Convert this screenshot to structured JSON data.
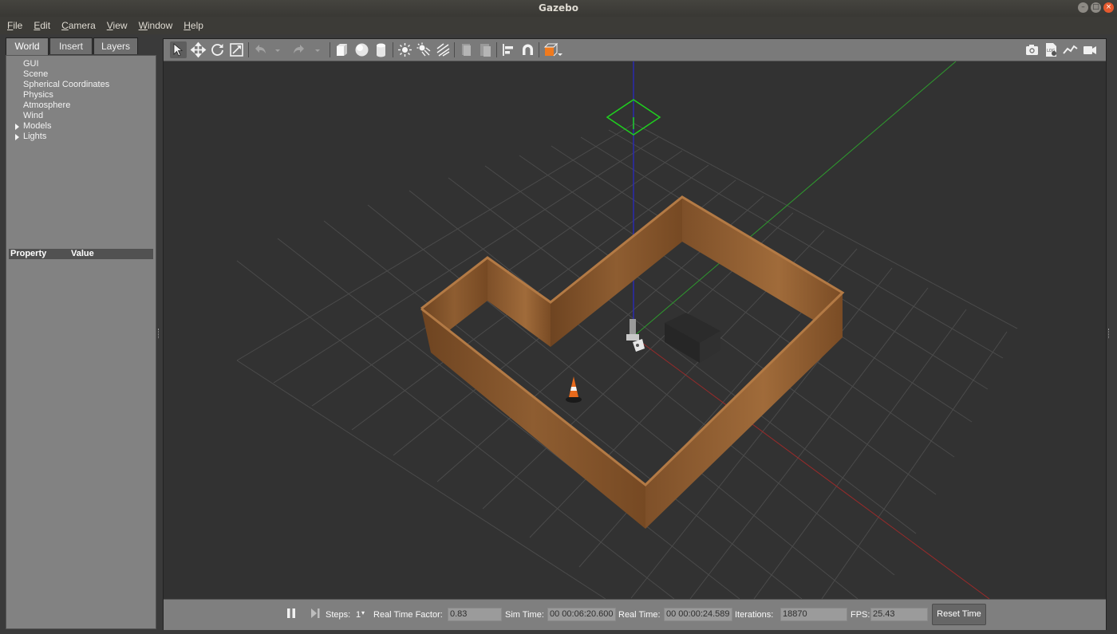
{
  "window": {
    "title": "Gazebo"
  },
  "menubar": [
    "File",
    "Edit",
    "Camera",
    "View",
    "Window",
    "Help"
  ],
  "left_panel": {
    "tabs": [
      "World",
      "Insert",
      "Layers"
    ],
    "active_tab": "World",
    "tree": [
      {
        "label": "GUI",
        "expandable": false
      },
      {
        "label": "Scene",
        "expandable": false
      },
      {
        "label": "Spherical Coordinates",
        "expandable": false
      },
      {
        "label": "Physics",
        "expandable": false
      },
      {
        "label": "Atmosphere",
        "expandable": false
      },
      {
        "label": "Wind",
        "expandable": false
      },
      {
        "label": "Models",
        "expandable": true
      },
      {
        "label": "Lights",
        "expandable": true
      }
    ],
    "property_header": {
      "property": "Property",
      "value": "Value"
    }
  },
  "toolbar": {
    "tools": [
      "select-mode",
      "translate-mode",
      "rotate-mode",
      "scale-mode",
      "undo",
      "undo-history",
      "redo",
      "redo-history",
      "box",
      "sphere",
      "cylinder",
      "point-light",
      "spot-light",
      "directional-light",
      "copy",
      "paste",
      "align",
      "snap",
      "change-view"
    ],
    "right_tools": [
      "screenshot",
      "log",
      "plot",
      "video-record"
    ]
  },
  "status_bar": {
    "steps_label": "Steps:",
    "steps_value": "1",
    "real_time_factor_label": "Real Time Factor:",
    "real_time_factor": "0.83",
    "sim_time_label": "Sim Time:",
    "sim_time": "00 00:06:20.600",
    "real_time_label": "Real Time:",
    "real_time": "00 00:00:24.589",
    "iterations_label": "Iterations:",
    "iterations": "18870",
    "fps_label": "FPS:",
    "fps": "25.43",
    "reset_label": "Reset Time"
  },
  "colors": {
    "wall": "#8a5a2e",
    "grid": "#4a4a4a",
    "axis_x": "#9b2a2a",
    "axis_y": "#2e9a2e",
    "axis_z": "#2a2ab0",
    "sun_marker": "#1fd01f"
  }
}
